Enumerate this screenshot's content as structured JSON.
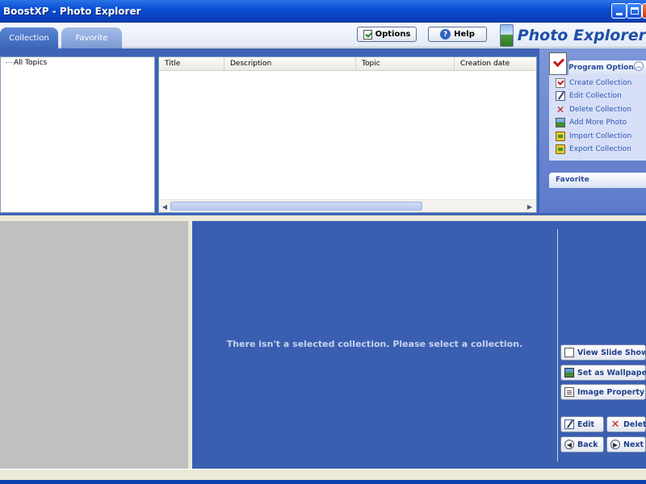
{
  "window": {
    "title": "BoostXP - Photo Explorer"
  },
  "tabs": [
    {
      "label": "Collection"
    },
    {
      "label": "Favorite"
    }
  ],
  "toolbar": {
    "options_label": "Options",
    "help_label": "Help"
  },
  "logo": {
    "text": "Photo Explorer"
  },
  "tree": {
    "root_label": "All Topics"
  },
  "list": {
    "columns": [
      "Title",
      "Description",
      "Topic",
      "Creation date"
    ]
  },
  "program_options": {
    "title": "Program Options",
    "items": [
      {
        "label": "Create Collection",
        "icon": "checkmark-icon"
      },
      {
        "label": "Edit Collection",
        "icon": "edit-icon"
      },
      {
        "label": "Delete Collection",
        "icon": "delete-icon"
      },
      {
        "label": "Add More Photo",
        "icon": "photo-icon"
      },
      {
        "label": "Import Collection",
        "icon": "import-icon"
      },
      {
        "label": "Export Collection",
        "icon": "export-icon"
      }
    ]
  },
  "favorite_panel": {
    "title": "Favorite"
  },
  "viewer": {
    "message": "There isn't a selected collection. Please select a collection."
  },
  "actions": {
    "view_slide_show": "View Slide Show",
    "set_as_wallpaper": "Set as Wallpaper",
    "image_property": "Image Property",
    "edit": "Edit",
    "delete": "Delete",
    "back": "Back",
    "next": "Next"
  },
  "colors": {
    "title_bar": "#0a4fd6",
    "frame_blue": "#3e63b6",
    "viewer_blue": "#3a5fb0",
    "link_blue": "#2c55b2",
    "delete_red": "#c41a1a"
  }
}
